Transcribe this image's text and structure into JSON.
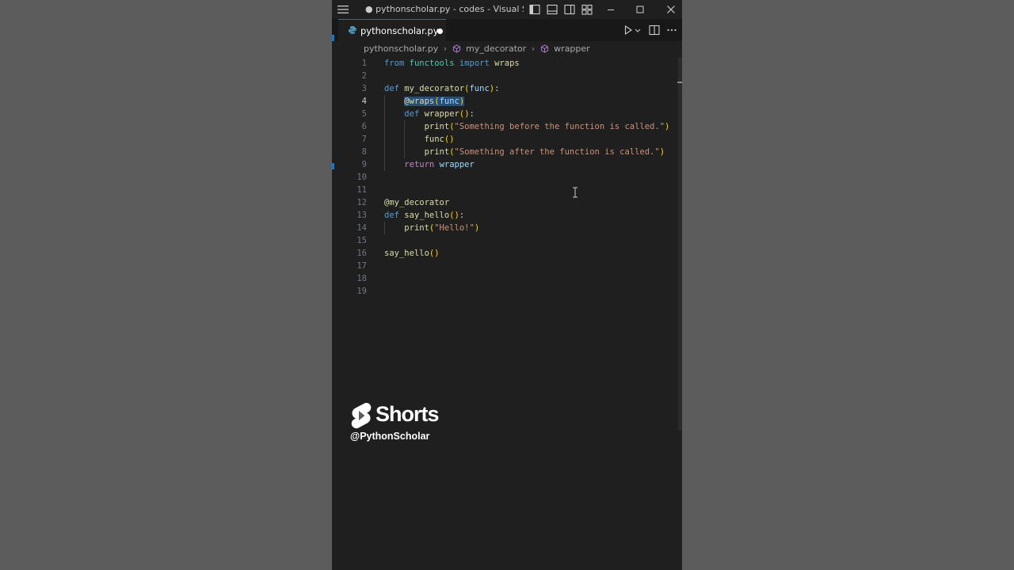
{
  "window": {
    "title": "● pythonscholar.py - codes - Visual Studio..."
  },
  "tab": {
    "label": "pythonscholar.py"
  },
  "breadcrumb": {
    "file": "pythonscholar.py",
    "symbol1": "my_decorator",
    "symbol2": "wrapper"
  },
  "editor": {
    "active_line": 4,
    "line_numbers": [
      "1",
      "2",
      "3",
      "4",
      "5",
      "6",
      "7",
      "8",
      "9",
      "10",
      "11",
      "12",
      "13",
      "14",
      "15",
      "16",
      "17",
      "18",
      "19"
    ],
    "lines": [
      "from functools import wraps",
      "",
      "def my_decorator(func):",
      "    @wraps(func)",
      "    def wrapper():",
      "        print(\"Something before the function is called.\")",
      "        func()",
      "        print(\"Something after the function is called.\")",
      "    return wrapper",
      "",
      "",
      "@my_decorator",
      "def say_hello():",
      "    print(\"Hello!\")",
      "",
      "say_hello()",
      "",
      "",
      ""
    ]
  },
  "watermark": {
    "brand": "Shorts",
    "handle": "@PythonScholar"
  },
  "colors": {
    "accent": "#0078d4",
    "keyword": "#569cd6",
    "control": "#c586c0",
    "function": "#dcdcaa",
    "string": "#ce9178",
    "selection": "#264f78"
  }
}
